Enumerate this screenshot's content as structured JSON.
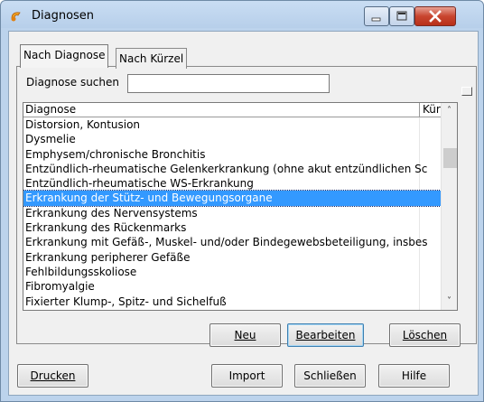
{
  "window": {
    "title": "Diagnosen",
    "accent": "#3399ff"
  },
  "tabs": [
    {
      "label": "Nach Diagnose",
      "active": true
    },
    {
      "label": "Nach Kürzel",
      "active": false
    }
  ],
  "search": {
    "label": "Diagnose suchen",
    "value": "",
    "placeholder": ""
  },
  "list": {
    "columns": [
      "Diagnose",
      "Kür"
    ],
    "rows": [
      "Distorsion, Kontusion",
      "Dysmelie",
      "Emphysem/chronische Bronchitis",
      "Entzündlich-rheumatische Gelenkerkrankung (ohne akut entzündlichen Sc",
      "Entzündlich-rheumatische WS-Erkrankung",
      "Erkrankung der Stütz- und Bewegungsorgane",
      "Erkrankung des Nervensystems",
      "Erkrankung des Rückenmarks",
      "Erkrankung mit Gefäß-, Muskel- und/oder Bindegewebsbeteiligung, insbes",
      "Erkrankung peripherer Gefäße",
      "Fehlbildungsskoliose",
      "Fibromyalgie",
      "Fixierter Klump-, Spitz- und Sichelfuß"
    ],
    "selected_index": 5,
    "scroll_up_icon": "chevron-up-icon",
    "scroll_down_icon": "chevron-down-icon"
  },
  "actions": {
    "neu": "Neu",
    "bearbeiten": "Bearbeiten",
    "loeschen": "Löschen"
  },
  "footer": {
    "drucken": "Drucken",
    "import": "Import",
    "schliessen": "Schließen",
    "hilfe": "Hilfe"
  }
}
